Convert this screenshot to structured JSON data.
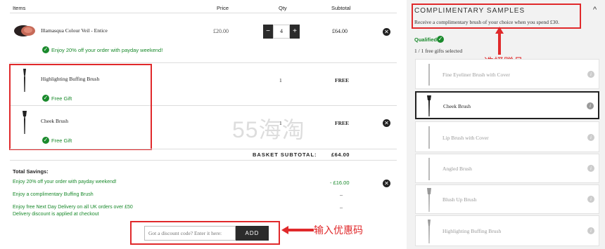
{
  "headers": {
    "items": "Items",
    "price": "Price",
    "qty": "Qty",
    "subtotal": "Subtotal"
  },
  "items": [
    {
      "name": "Illamasqua Colour Veil - Entice",
      "price": "£20.00",
      "qty": "4",
      "subtotal": "£64.00",
      "promo": "Enjoy 20% off your order with payday weekend!"
    },
    {
      "name": "Highlighting Buffing Brush",
      "qty": "1",
      "subtotal": "FREE",
      "promo": "Free Gift"
    },
    {
      "name": "Cheek Brush",
      "qty": "1",
      "subtotal": "FREE",
      "promo": "Free Gift"
    }
  ],
  "qty_controls": {
    "minus": "−",
    "plus": "+"
  },
  "basket": {
    "label": "BASKET SUBTOTAL:",
    "value": "£64.00"
  },
  "savings": {
    "title": "Total Savings:",
    "lines": [
      {
        "text": "Enjoy 20% off your order with payday weekend!",
        "value": "- £16.00"
      },
      {
        "text": "Enjoy a complimentary Buffing Brush",
        "value": "–"
      },
      {
        "text": "Enjoy free Next Day Delivery on all UK orders over £50",
        "value": "–"
      }
    ],
    "note": "Delivery discount is applied at checkout"
  },
  "discount": {
    "placeholder": "Got a discount code? Enter it here:",
    "button": "ADD"
  },
  "samples": {
    "title": "COMPLIMENTARY SAMPLES",
    "subtitle": "Receive a complimentary brush of your choice when you spend £30.",
    "qualified": "Qualified",
    "count": "1 / 1 free gifts selected",
    "gifts": [
      "Fine Eyeliner Brush with Cover",
      "Cheek Brush",
      "Lip Brush with Cover",
      "Angled Brush",
      "Blush Up Brush",
      "Highlighting Buffing Brush"
    ],
    "info_glyph": "i",
    "collapse_glyph": "^"
  },
  "annotations": {
    "gift": "选择赠品",
    "code": "输入优惠码"
  },
  "watermark": "55海淘",
  "icons": {
    "check": "check-circle-icon",
    "remove": "remove-x-icon",
    "info": "info-icon",
    "arrow": "red-arrow-icon"
  },
  "colors": {
    "green": "#1a8a2c",
    "annotation": "#e0292b",
    "button": "#2b2b2b"
  }
}
